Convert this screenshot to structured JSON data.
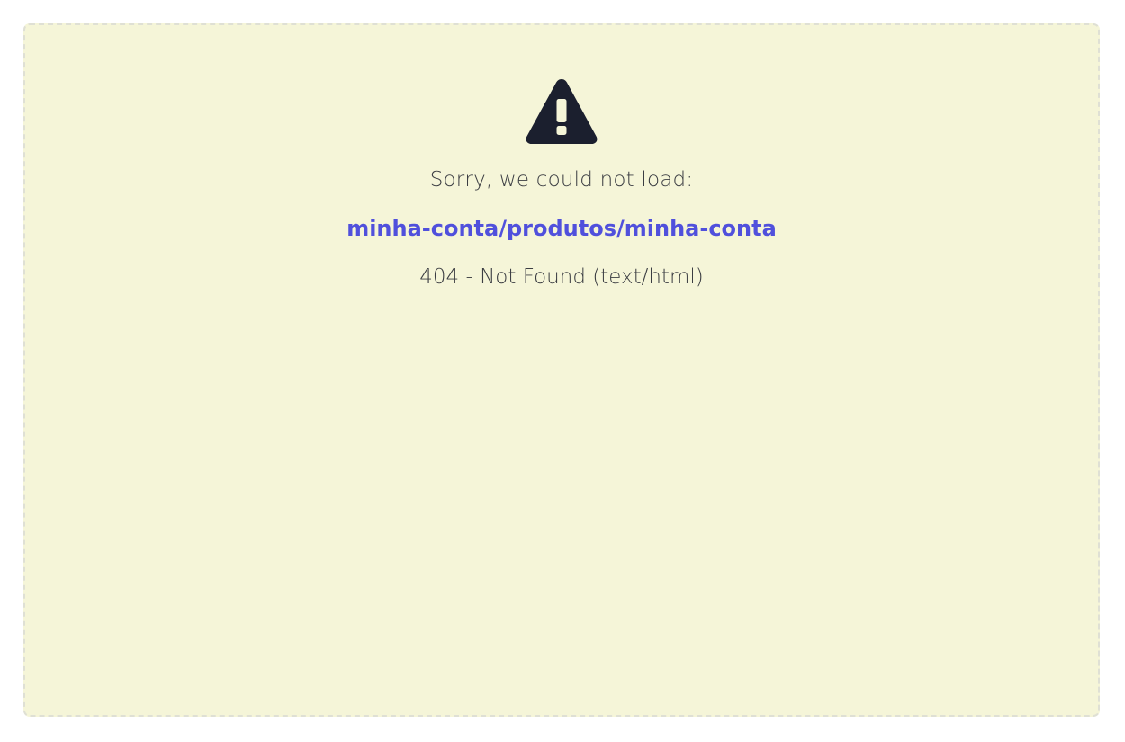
{
  "error_panel": {
    "icon": "warning-icon",
    "message": "Sorry, we could not load:",
    "path": "minha-conta/produtos/minha-conta",
    "status": "404 - Not Found (text/html)"
  },
  "colors": {
    "panel_background": "#f5f5d8",
    "panel_border": "#dfe0d4",
    "icon": "#1b1f2e",
    "link": "#5050dc",
    "text": "#3b3d42"
  }
}
